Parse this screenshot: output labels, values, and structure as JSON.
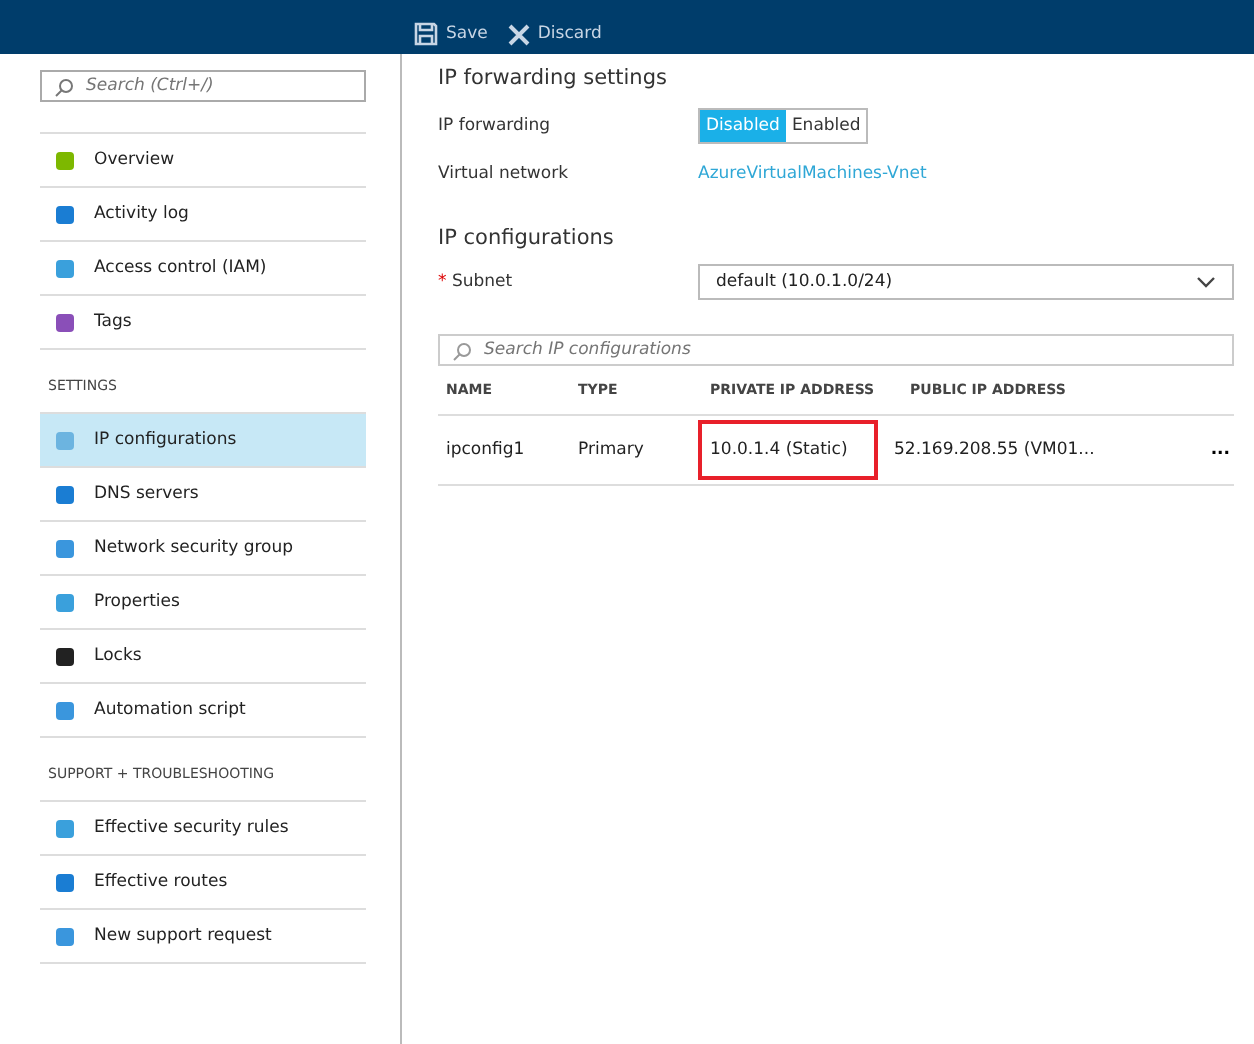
{
  "header": {
    "toolbar": [
      {
        "kind": "save",
        "label": "Save"
      },
      {
        "kind": "discard",
        "label": "Discard"
      }
    ]
  },
  "sidebar": {
    "search": {
      "placeholder": "Search (Ctrl+/)"
    },
    "groups": [
      {
        "items": [
          {
            "label": "Overview",
            "selected": false
          },
          {
            "label": "Activity log",
            "selected": false
          },
          {
            "label": "Access control (IAM)",
            "selected": false
          },
          {
            "label": "Tags",
            "selected": false
          }
        ]
      },
      {
        "heading": "SETTINGS",
        "items": [
          {
            "label": "IP configurations",
            "selected": true
          },
          {
            "label": "DNS servers",
            "selected": false
          },
          {
            "label": "Network security group",
            "selected": false
          },
          {
            "label": "Properties",
            "selected": false
          },
          {
            "label": "Locks",
            "selected": false
          },
          {
            "label": "Automation script",
            "selected": false
          }
        ]
      },
      {
        "heading": "SUPPORT + TROUBLESHOOTING",
        "items": [
          {
            "label": "Effective security rules",
            "selected": false
          },
          {
            "label": "Effective routes",
            "selected": false
          },
          {
            "label": "New support request",
            "selected": false
          }
        ]
      }
    ]
  },
  "forwarding": {
    "heading": "IP forwarding settings",
    "label": "IP forwarding",
    "options": [
      {
        "label": "Disabled",
        "selected": true
      },
      {
        "label": "Enabled",
        "selected": false
      }
    ],
    "vnet_label": "Virtual network",
    "vnet_link": "AzureVirtualMachines-Vnet"
  },
  "ipconfigs": {
    "heading": "IP configurations",
    "subnet_label": "Subnet",
    "subnet_required_mark": "*",
    "subnet_value": "default (10.0.1.0/24)",
    "search": {
      "placeholder": "Search IP configurations"
    },
    "table": {
      "columns": [
        "NAME",
        "TYPE",
        "PRIVATE IP ADDRESS",
        "PUBLIC IP ADDRESS"
      ],
      "rows": [
        {
          "cells": [
            {
              "text": "ipconfig1",
              "highlighted": false
            },
            {
              "text": "Primary",
              "highlighted": false
            },
            {
              "text": "10.0.1.4 (Static)",
              "highlighted": true
            },
            {
              "text": "52.169.208.55 (VM01...",
              "highlighted": false
            }
          ],
          "more": "..."
        }
      ]
    }
  }
}
